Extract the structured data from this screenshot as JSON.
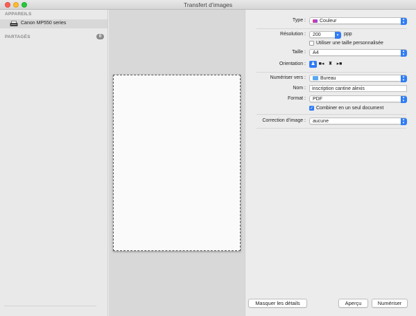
{
  "window": {
    "title": "Transfert d’images"
  },
  "sidebar": {
    "devices_heading": "APPAREILS",
    "device_name": "Canon MP550 series",
    "shared_heading": "PARTAGÉS",
    "shared_count": "0"
  },
  "settings": {
    "type_label": "Type :",
    "type_value": "Couleur",
    "resolution_label": "Résolution :",
    "resolution_value": "200",
    "resolution_unit": "ppp",
    "custom_size_label": "Utiliser une taille personnalisée",
    "size_label": "Taille :",
    "size_value": "A4",
    "orientation_label": "Orientation :",
    "scan_to_label": "Numériser vers :",
    "scan_to_value": "Bureau",
    "name_label": "Nom :",
    "name_value": "inscription cantine alexis",
    "format_label": "Format :",
    "format_value": "PDF",
    "combine_label": "Combiner en un seul document",
    "image_correction_label": "Correction d’image :",
    "image_correction_value": "aucune"
  },
  "buttons": {
    "hide_details": "Masquer les détails",
    "preview": "Aperçu",
    "scan": "Numériser"
  },
  "colors": {
    "accent": "#2f7cf6"
  }
}
